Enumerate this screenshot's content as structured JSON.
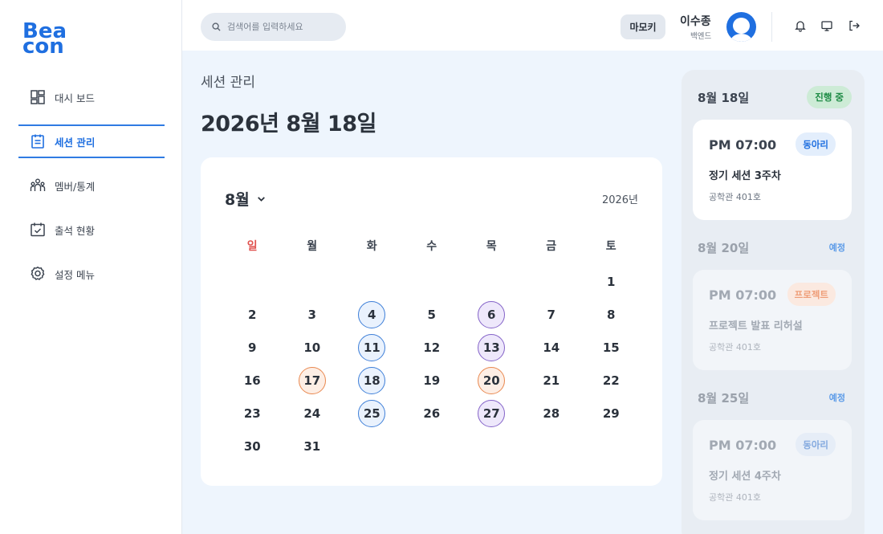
{
  "brand": {
    "logo_line1": "Bea",
    "logo_line2": "con",
    "color": "#1f6fe0"
  },
  "sidebar": {
    "items": [
      {
        "label": "대시 보드",
        "icon": "dashboard-icon",
        "active": false
      },
      {
        "label": "세션 관리",
        "icon": "calendar-note-icon",
        "active": true
      },
      {
        "label": "멤버/통계",
        "icon": "members-icon",
        "active": false
      },
      {
        "label": "출석 현황",
        "icon": "attendance-icon",
        "active": false
      },
      {
        "label": "설정 메뉴",
        "icon": "gear-icon",
        "active": false
      }
    ]
  },
  "header": {
    "search_placeholder": "검색어를 입력하세요",
    "mamoki_label": "마모키",
    "user_name": "이수종",
    "user_role": "백엔드",
    "icons": [
      "bell-icon",
      "monitor-icon",
      "logout-icon"
    ]
  },
  "main": {
    "breadcrumb": "세션 관리",
    "date_title": "2026년 8월 18일"
  },
  "calendar": {
    "month_label": "8월",
    "year_label": "2026년",
    "weekdays": [
      "일",
      "월",
      "화",
      "수",
      "목",
      "금",
      "토"
    ],
    "weeks": [
      [
        {
          "d": "",
          "t": ""
        },
        {
          "d": "",
          "t": ""
        },
        {
          "d": "",
          "t": ""
        },
        {
          "d": "",
          "t": ""
        },
        {
          "d": "",
          "t": ""
        },
        {
          "d": "",
          "t": ""
        },
        {
          "d": "1",
          "t": ""
        }
      ],
      [
        {
          "d": "2",
          "t": ""
        },
        {
          "d": "3",
          "t": ""
        },
        {
          "d": "4",
          "t": "blue"
        },
        {
          "d": "5",
          "t": ""
        },
        {
          "d": "6",
          "t": "purple"
        },
        {
          "d": "7",
          "t": ""
        },
        {
          "d": "8",
          "t": ""
        }
      ],
      [
        {
          "d": "9",
          "t": ""
        },
        {
          "d": "10",
          "t": ""
        },
        {
          "d": "11",
          "t": "blue"
        },
        {
          "d": "12",
          "t": ""
        },
        {
          "d": "13",
          "t": "purple"
        },
        {
          "d": "14",
          "t": ""
        },
        {
          "d": "15",
          "t": ""
        }
      ],
      [
        {
          "d": "16",
          "t": ""
        },
        {
          "d": "17",
          "t": "orange"
        },
        {
          "d": "18",
          "t": "blue"
        },
        {
          "d": "19",
          "t": ""
        },
        {
          "d": "20",
          "t": "orange"
        },
        {
          "d": "21",
          "t": ""
        },
        {
          "d": "22",
          "t": ""
        }
      ],
      [
        {
          "d": "23",
          "t": ""
        },
        {
          "d": "24",
          "t": ""
        },
        {
          "d": "25",
          "t": "blue"
        },
        {
          "d": "26",
          "t": ""
        },
        {
          "d": "27",
          "t": "purple"
        },
        {
          "d": "28",
          "t": ""
        },
        {
          "d": "29",
          "t": ""
        }
      ],
      [
        {
          "d": "30",
          "t": ""
        },
        {
          "d": "31",
          "t": ""
        },
        {
          "d": "",
          "t": ""
        },
        {
          "d": "",
          "t": ""
        },
        {
          "d": "",
          "t": ""
        },
        {
          "d": "",
          "t": ""
        },
        {
          "d": "",
          "t": ""
        }
      ]
    ],
    "colors": {
      "club": "#3e7fd8",
      "regular": "#8463c8",
      "project": "#e9884f",
      "sunday": "#e0524f"
    }
  },
  "schedule": {
    "groups": [
      {
        "date": "8월 18일",
        "tag": "진행 중",
        "card": {
          "time": "PM 07:00",
          "badge": "동아리",
          "title": "정기 세션 3주차",
          "place": "공학관 401호"
        }
      },
      {
        "date": "8월 20일",
        "tag": "예정",
        "card": {
          "time": "PM 07:00",
          "badge": "프로젝트",
          "title": "프로젝트 발표 리허설",
          "place": "공학관 401호"
        }
      },
      {
        "date": "8월 25일",
        "tag": "예정",
        "card": {
          "time": "PM 07:00",
          "badge": "동아리",
          "title": "정기 세션 4주차",
          "place": "공학관 401호"
        }
      }
    ]
  }
}
